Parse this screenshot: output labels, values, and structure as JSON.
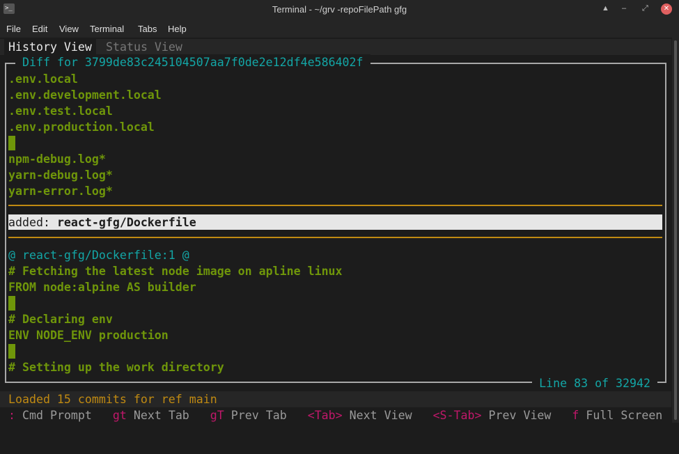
{
  "window": {
    "title": "Terminal - ~/grv -repoFilePath gfg"
  },
  "menu": [
    "File",
    "Edit",
    "View",
    "Terminal",
    "Tabs",
    "Help"
  ],
  "tabs": [
    {
      "label": "History View",
      "active": true
    },
    {
      "label": "Status View",
      "active": false
    }
  ],
  "diff": {
    "title": "Diff for 3799de83c245104507aa7f0de2e12df4e586402f",
    "lines_top": [
      ".env.local",
      ".env.development.local",
      ".env.test.local",
      ".env.production.local",
      "",
      "npm-debug.log*",
      "yarn-debug.log*",
      "yarn-error.log*"
    ],
    "added_prefix": "added: ",
    "added_file": "react-gfg/Dockerfile",
    "hunk": "@ react-gfg/Dockerfile:1 @",
    "lines_bottom": [
      "# Fetching the latest node image on apline linux",
      "FROM node:alpine AS builder",
      "",
      "# Declaring env",
      "ENV NODE_ENV production",
      "",
      "# Setting up the work directory"
    ],
    "position": "Line 83 of 32942"
  },
  "status": "Loaded 15 commits for ref main",
  "help": [
    {
      "key": ":",
      "label": "Cmd Prompt"
    },
    {
      "key": "gt",
      "label": "Next Tab"
    },
    {
      "key": "gT",
      "label": "Prev Tab"
    },
    {
      "key": "<Tab>",
      "label": "Next View"
    },
    {
      "key": "<S-Tab>",
      "label": "Prev View"
    },
    {
      "key": "f",
      "label": "Full Screen"
    }
  ],
  "colors": {
    "added": "#6f960a",
    "header": "#13a6a6",
    "divider": "#c08a12",
    "key": "#c0186a"
  }
}
